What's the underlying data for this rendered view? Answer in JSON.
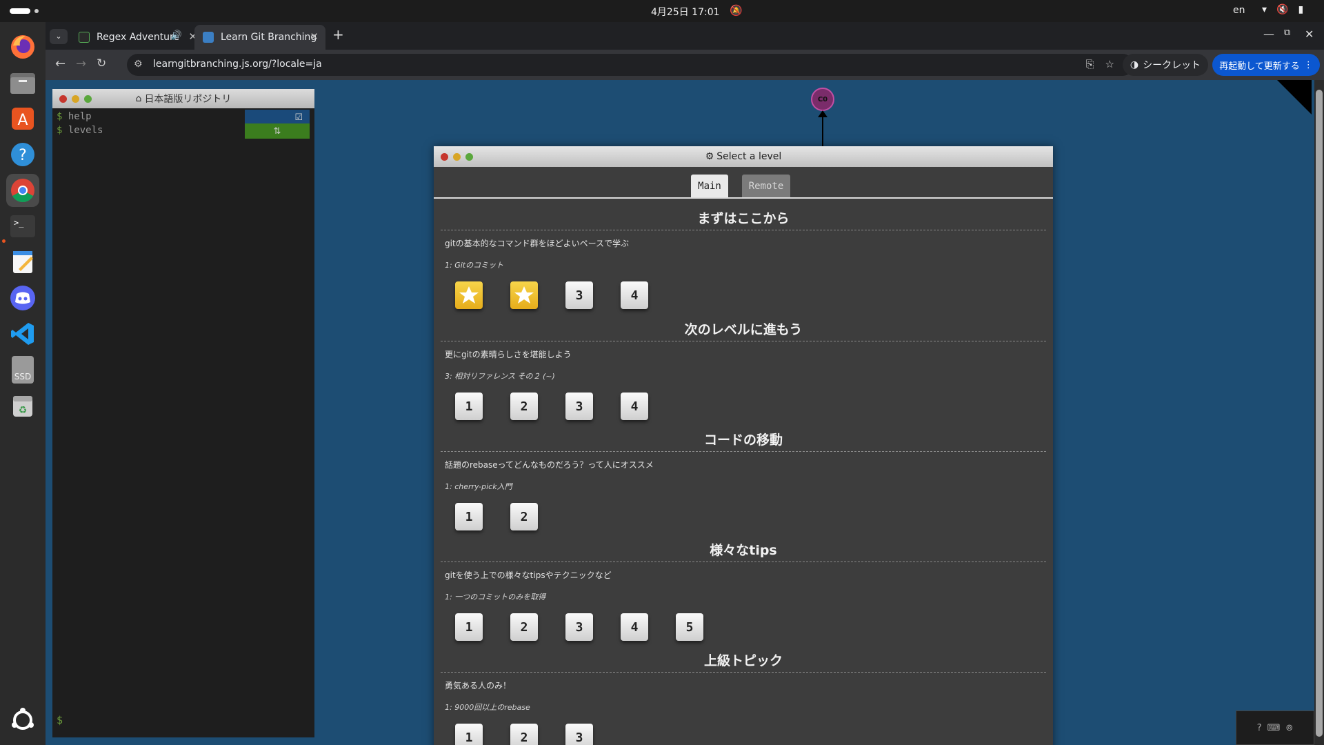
{
  "system": {
    "clock": "4月25日 17:01",
    "language": "en",
    "tray_icons": [
      "wifi-icon",
      "volume-muted-icon",
      "battery-icon"
    ]
  },
  "dock": {
    "items": [
      "firefox",
      "files",
      "app-center",
      "help",
      "chrome",
      "terminal",
      "text-editor",
      "discord",
      "vscode",
      "ssd-drive",
      "trash",
      "show-apps"
    ],
    "ssd_label": "SSD"
  },
  "browser": {
    "tabs": [
      {
        "title": "Regex Adventure Bro",
        "audio": true,
        "active": false
      },
      {
        "title": "Learn Git Branching",
        "audio": false,
        "active": true
      }
    ],
    "new_tab": "+",
    "url": "learngitbranching.js.org/?locale=ja",
    "incognito_label": "シークレット",
    "restart_label": "再起動して更新する"
  },
  "terminal": {
    "title": "日本語版リポジトリ",
    "commands": [
      {
        "text": "help"
      },
      {
        "text": "levels"
      }
    ],
    "prompt": "$"
  },
  "graph": {
    "commit_label": "C0"
  },
  "modal": {
    "title": "Select a level",
    "tabs": {
      "main": "Main",
      "remote": "Remote"
    },
    "sections": [
      {
        "title": "まずはここから",
        "desc": "gitの基本的なコマンド群をほどよいペースで学ぶ",
        "current": "1: Gitのコミット",
        "levels": [
          {
            "label": "1",
            "done": true
          },
          {
            "label": "2",
            "done": true
          },
          {
            "label": "3",
            "done": false
          },
          {
            "label": "4",
            "done": false
          }
        ]
      },
      {
        "title": "次のレベルに進もう",
        "desc": "更にgitの素晴らしさを堪能しよう",
        "current": "3: 相対リファレンス その２ (~)",
        "levels": [
          {
            "label": "1",
            "done": false
          },
          {
            "label": "2",
            "done": false
          },
          {
            "label": "3",
            "done": false
          },
          {
            "label": "4",
            "done": false
          }
        ]
      },
      {
        "title": "コードの移動",
        "desc": "話題のrebaseってどんなものだろう？って人にオススメ",
        "current": "1: cherry-pick入門",
        "levels": [
          {
            "label": "1",
            "done": false
          },
          {
            "label": "2",
            "done": false
          }
        ]
      },
      {
        "title": "様々なtips",
        "desc": "gitを使う上での様々なtipsやテクニックなど",
        "current": "1: 一つのコミットのみを取得",
        "levels": [
          {
            "label": "1",
            "done": false
          },
          {
            "label": "2",
            "done": false
          },
          {
            "label": "3",
            "done": false
          },
          {
            "label": "4",
            "done": false
          },
          {
            "label": "5",
            "done": false
          }
        ]
      },
      {
        "title": "上級トピック",
        "desc": "勇気ある人のみ！",
        "current": "1: 9000回以上のrebase",
        "levels": [
          {
            "label": "1",
            "done": false
          },
          {
            "label": "2",
            "done": false
          },
          {
            "label": "3",
            "done": false
          }
        ]
      }
    ]
  },
  "colors": {
    "page_bg": "#1d4d73",
    "level_done": "#f0c437",
    "help_badge": "#1a4a7a",
    "levels_badge": "#3b7d1e"
  }
}
